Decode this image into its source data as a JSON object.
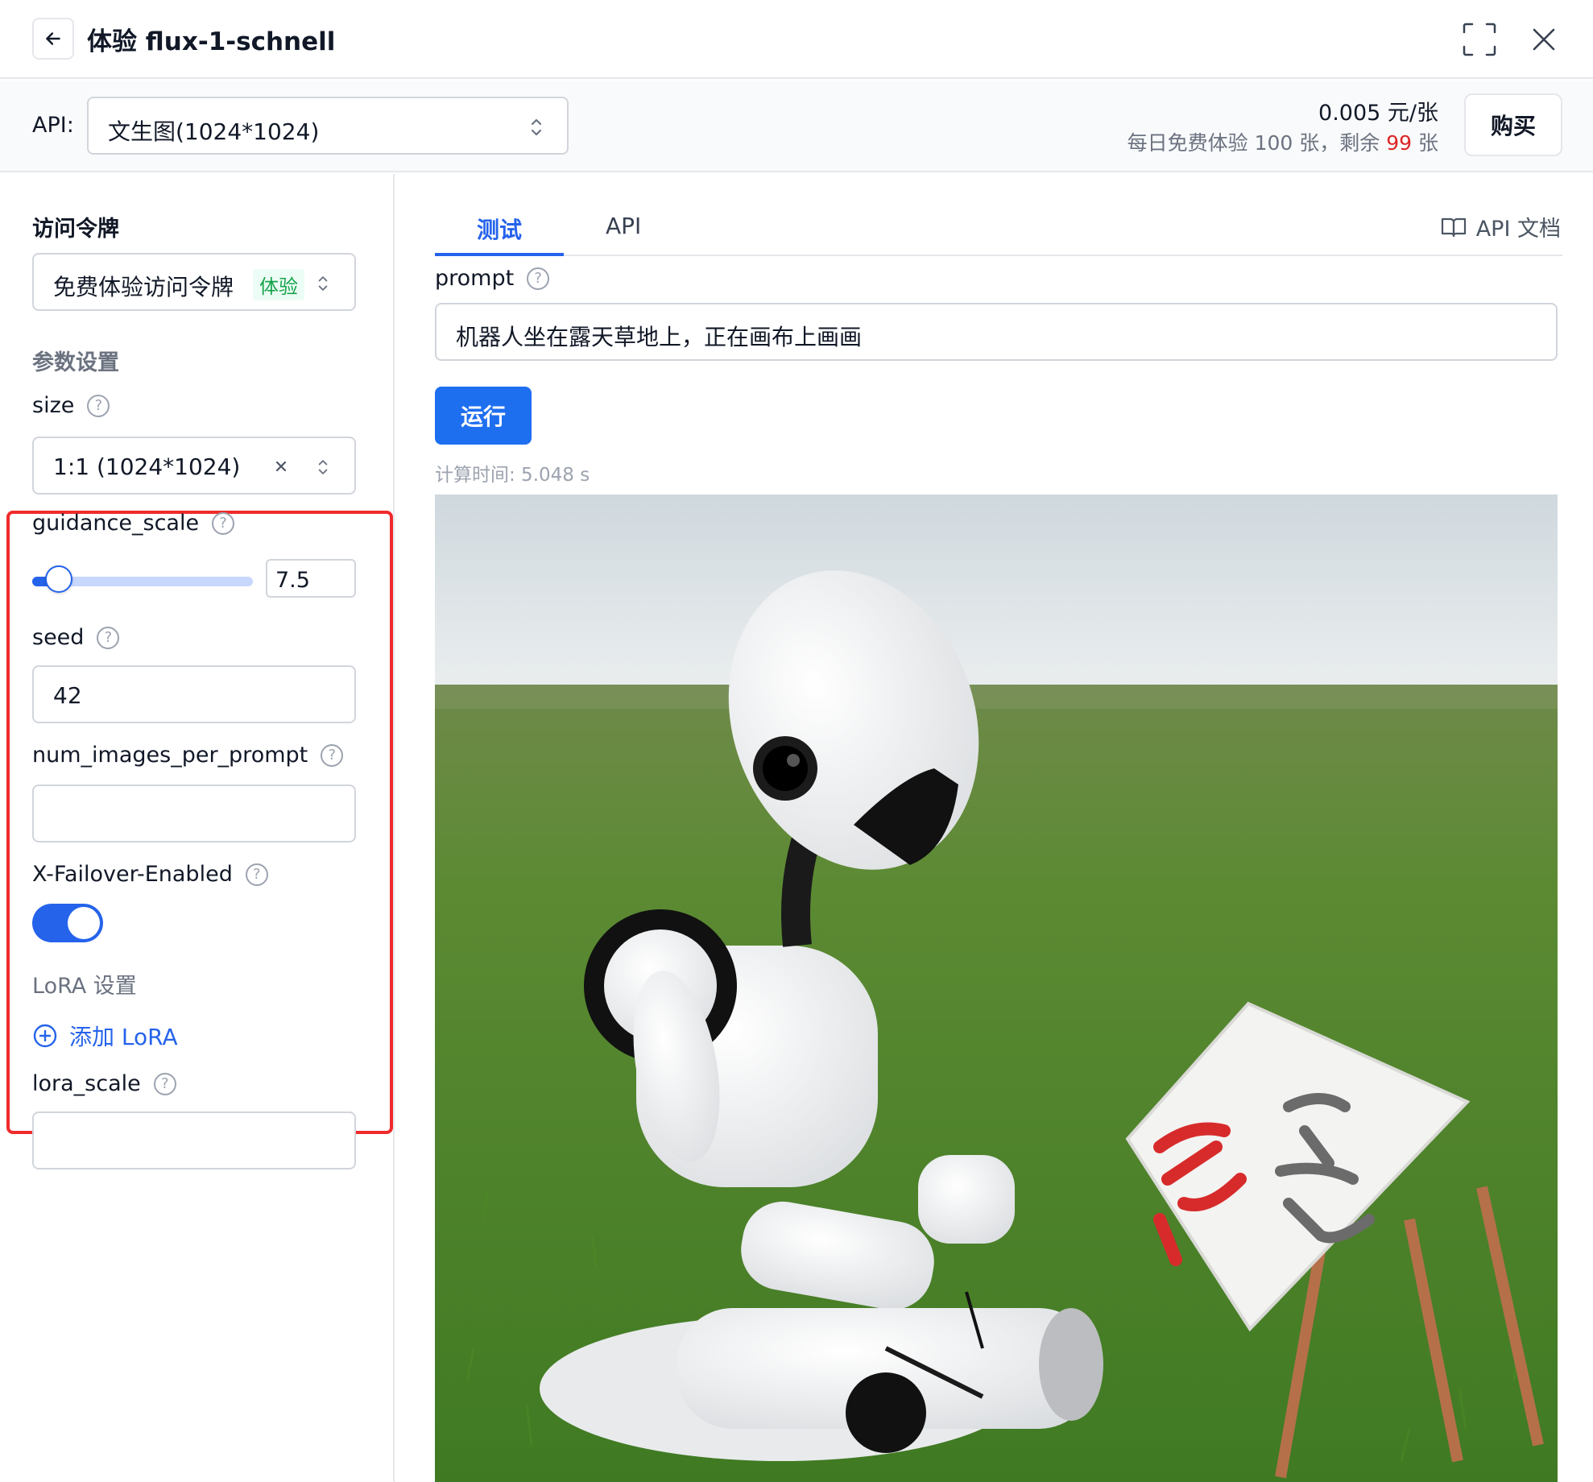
{
  "header": {
    "title": "体验  flux-1-schnell"
  },
  "api_bar": {
    "label": "API:",
    "selected_api": "文生图(1024*1024)",
    "price": "0.005 元/张",
    "quota_prefix": "每日免费体验 100 张，剩余 ",
    "quota_remaining": "99",
    "quota_suffix": " 张",
    "buy_label": "购买"
  },
  "left": {
    "token_title": "访问令牌",
    "token_value": "免费体验访问令牌",
    "token_badge": "体验",
    "params_title": "参数设置",
    "size_label": "size",
    "size_value": "1:1 (1024*1024)",
    "guidance_label": "guidance_scale",
    "guidance_value": "7.5",
    "guidance_fraction": 0.12,
    "seed_label": "seed",
    "seed_value": "42",
    "num_images_label": "num_images_per_prompt",
    "num_images_value": "",
    "failover_label": "X-Failover-Enabled",
    "failover_enabled": true,
    "lora_title": "LoRA 设置",
    "add_lora_label": "添加 LoRA",
    "lora_scale_label": "lora_scale",
    "lora_scale_value": ""
  },
  "right": {
    "tabs": [
      {
        "label": "测试",
        "active": true
      },
      {
        "label": "API",
        "active": false
      }
    ],
    "api_doc_label": "API 文档",
    "prompt_label": "prompt",
    "prompt_value": "机器人坐在露天草地上，正在画布上画画",
    "run_label": "运行",
    "calc_time": "计算时间: 5.048 s"
  },
  "colors": {
    "accent": "#2563eb",
    "highlight_border": "#ef2b2b",
    "badge_green": "#16a34a",
    "remaining_red": "#dc2626"
  },
  "icons": [
    "arrow-left-icon",
    "fullscreen-icon",
    "close-icon",
    "chevron-updown-icon",
    "help-icon",
    "clear-icon",
    "plus-circle-icon",
    "book-icon"
  ]
}
